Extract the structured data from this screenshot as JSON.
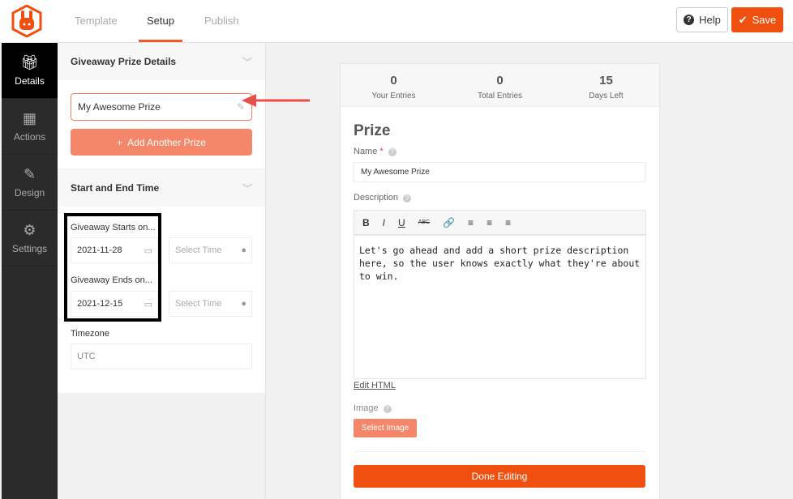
{
  "header": {
    "tabs": [
      "Template",
      "Setup",
      "Publish"
    ],
    "help_label": "Help",
    "save_label": "Save"
  },
  "sidebar": {
    "items": [
      {
        "label": "Details"
      },
      {
        "label": "Actions"
      },
      {
        "label": "Design"
      },
      {
        "label": "Settings"
      }
    ]
  },
  "panel": {
    "section1": "Giveaway Prize Details",
    "prize_name": "My Awesome Prize",
    "add_prize": "Add Another Prize",
    "section2": "Start and End Time",
    "starts_label": "Giveaway Starts on...",
    "start_date": "2021-11-28",
    "ends_label": "Giveaway Ends on...",
    "end_date": "2021-12-15",
    "time_placeholder": "Select Time",
    "timezone_label": "Timezone",
    "timezone": "UTC"
  },
  "preview": {
    "stats": [
      {
        "value": "0",
        "label": "Your Entries"
      },
      {
        "value": "0",
        "label": "Total Entries"
      },
      {
        "value": "15",
        "label": "Days Left"
      }
    ],
    "title": "Prize",
    "name_label": "Name",
    "required": "*",
    "name_value": "My Awesome Prize",
    "description_label": "Description",
    "toolbar": [
      "B",
      "I",
      "U",
      "ABC",
      "🔗",
      "≡",
      "≡",
      "≡"
    ],
    "description": "Let's go ahead and add a short prize description here, so the user knows exactly what they're about to win.",
    "edit_html": "Edit HTML",
    "image_label": "Image",
    "select_image": "Select Image",
    "done": "Done Editing"
  },
  "colors": {
    "accent": "#f0500f"
  }
}
